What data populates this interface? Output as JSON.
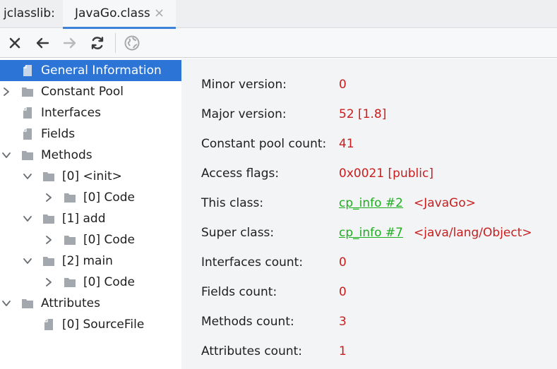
{
  "tabbar": {
    "tool_title": "jclasslib:",
    "tab_label": "JavaGo.class",
    "close_glyph": "×"
  },
  "toolbar": {
    "buttons": [
      "close-icon",
      "back-icon",
      "forward-icon",
      "refresh-icon",
      "web-icon"
    ]
  },
  "tree": {
    "items": [
      {
        "label": "General Information",
        "icon": "file-icon",
        "expander": "none",
        "selected": true
      },
      {
        "label": "Constant Pool",
        "icon": "folder-icon",
        "expander": "collapsed"
      },
      {
        "label": "Interfaces",
        "icon": "file-icon",
        "expander": "none"
      },
      {
        "label": "Fields",
        "icon": "file-icon",
        "expander": "none"
      },
      {
        "label": "Methods",
        "icon": "folder-icon",
        "expander": "expanded"
      },
      {
        "label": "[0] <init>",
        "icon": "folder-icon",
        "expander": "expanded"
      },
      {
        "label": "[0] Code",
        "icon": "folder-icon",
        "expander": "collapsed"
      },
      {
        "label": "[1] add",
        "icon": "folder-icon",
        "expander": "expanded"
      },
      {
        "label": "[0] Code",
        "icon": "folder-icon",
        "expander": "collapsed"
      },
      {
        "label": "[2] main",
        "icon": "folder-icon",
        "expander": "expanded"
      },
      {
        "label": "[0] Code",
        "icon": "folder-icon",
        "expander": "collapsed"
      },
      {
        "label": "Attributes",
        "icon": "folder-icon",
        "expander": "expanded"
      },
      {
        "label": "[0] SourceFile",
        "icon": "file-icon",
        "expander": "none"
      }
    ]
  },
  "general_info": {
    "minor_version": {
      "label": "Minor version:",
      "value": "0"
    },
    "major_version": {
      "label": "Major version:",
      "value": "52 [1.8]"
    },
    "constant_pool_count": {
      "label": "Constant pool count:",
      "value": "41"
    },
    "access_flags": {
      "label": "Access flags:",
      "value": "0x0021 [public]"
    },
    "this_class": {
      "label": "This class:",
      "link": "cp_info #2",
      "ref": "<JavaGo>"
    },
    "super_class": {
      "label": "Super class:",
      "link": "cp_info #7",
      "ref": "<java/lang/Object>"
    },
    "interfaces_count": {
      "label": "Interfaces count:",
      "value": "0"
    },
    "fields_count": {
      "label": "Fields count:",
      "value": "0"
    },
    "methods_count": {
      "label": "Methods count:",
      "value": "3"
    },
    "attributes_count": {
      "label": "Attributes count:",
      "value": "1"
    }
  },
  "colors": {
    "selection": "#2c75d6",
    "value_red": "#c81e1e",
    "link_green": "#1fae1f",
    "tab_underline": "#3d82d8"
  }
}
